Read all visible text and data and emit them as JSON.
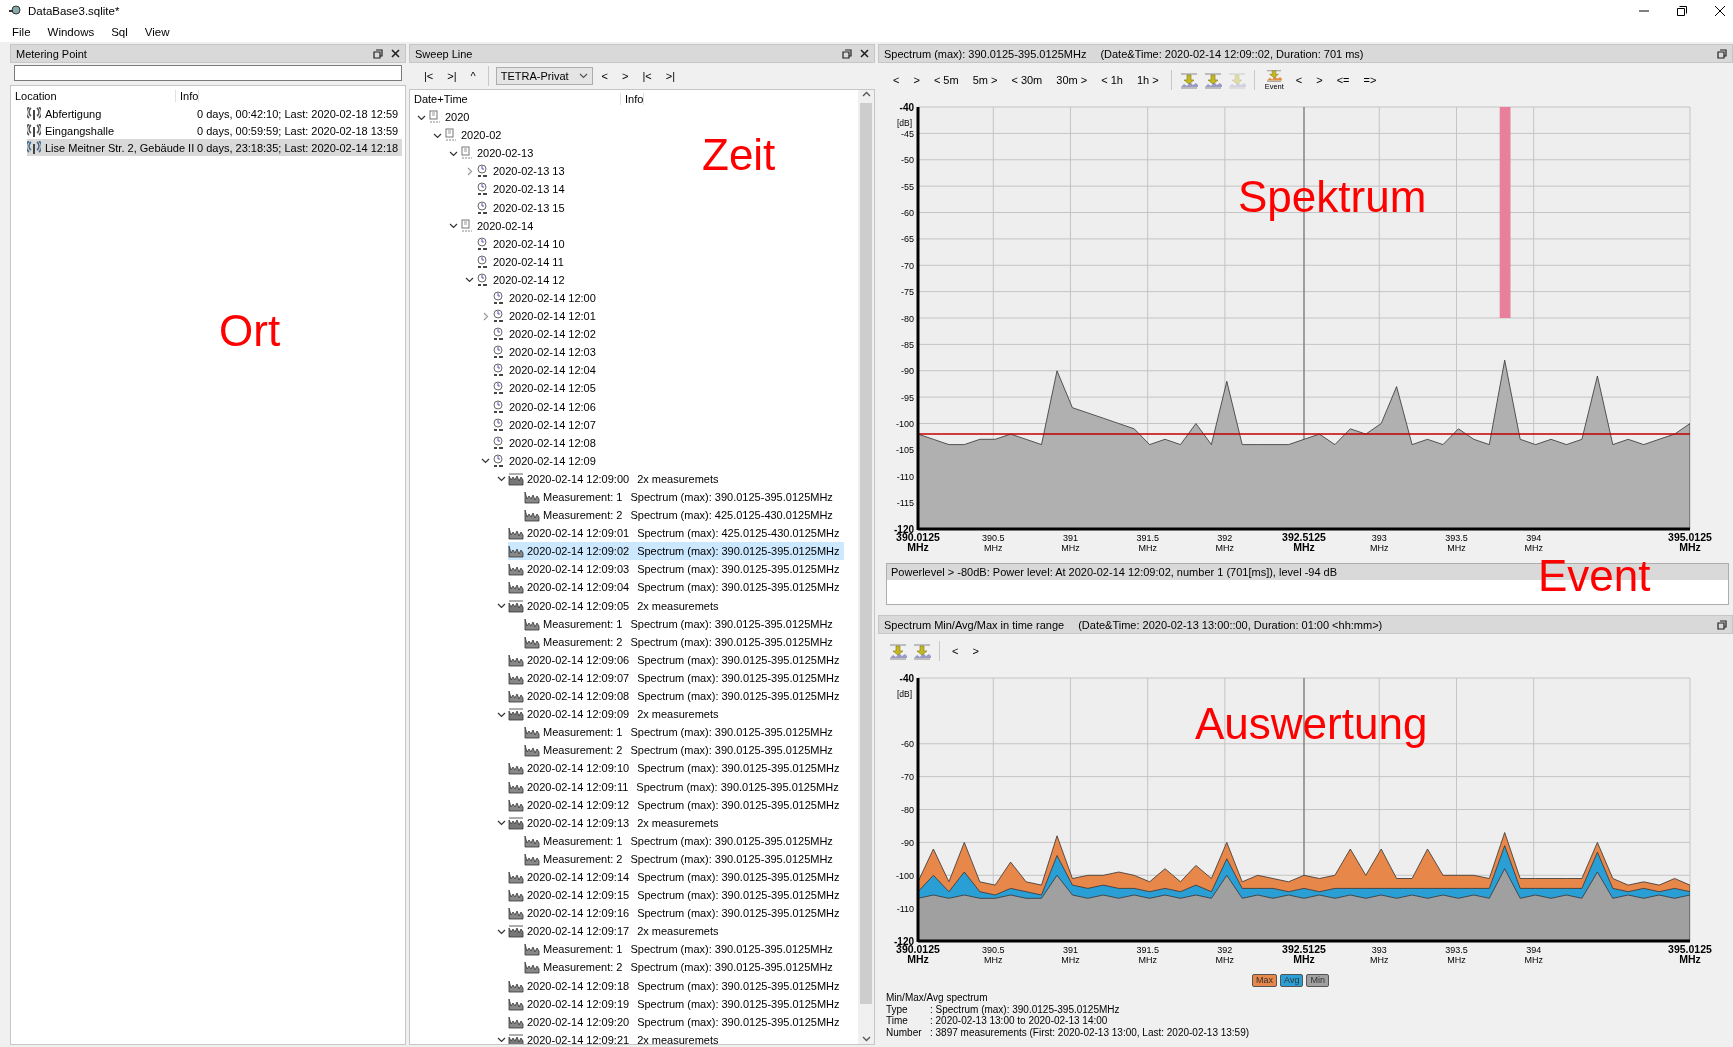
{
  "window": {
    "title": "DataBase3.sqlite*"
  },
  "menu": [
    "File",
    "Windows",
    "Sql",
    "View"
  ],
  "metering_point": {
    "title": "Metering Point",
    "columns": [
      "Location",
      "Info"
    ],
    "annotation": "Ort",
    "rows": [
      {
        "location": "Abfertigung",
        "info": "0 days, 00:42:10; Last: 2020-02-18 12:59",
        "selected": false
      },
      {
        "location": "Eingangshalle",
        "info": "0 days, 00:59:59; Last: 2020-02-18 13:59",
        "selected": false
      },
      {
        "location": "Lise Meitner Str. 2, Gebäude II",
        "info": "0 days, 23:18:35; Last: 2020-02-14 12:18",
        "selected": true
      }
    ]
  },
  "sweep_line": {
    "title": "Sweep Line",
    "annotation": "Zeit",
    "toolbar": [
      {
        "kind": "text",
        "label": "|<"
      },
      {
        "kind": "text",
        "label": ">|"
      },
      {
        "kind": "text",
        "label": "^"
      },
      {
        "kind": "separator"
      },
      {
        "kind": "dropdown",
        "label": "TETRA-Privat"
      },
      {
        "kind": "text",
        "label": "<"
      },
      {
        "kind": "text",
        "label": ">"
      },
      {
        "kind": "text",
        "label": "|<"
      },
      {
        "kind": "text",
        "label": ">|"
      }
    ],
    "columns": [
      "Date+Time",
      "Info"
    ],
    "tree": [
      {
        "label": "2020",
        "kind": "year",
        "expanded": true,
        "selected": false,
        "children": [
          {
            "label": "2020-02",
            "kind": "month",
            "expanded": true,
            "selected": false,
            "children": [
              {
                "label": "2020-02-13",
                "kind": "day",
                "expanded": true,
                "selected": false,
                "children": [
                  {
                    "label": "2020-02-13 13",
                    "kind": "hour",
                    "expanded": false,
                    "selected": false
                  },
                  {
                    "label": "2020-02-13 14",
                    "kind": "hour",
                    "selected": false
                  },
                  {
                    "label": "2020-02-13 15",
                    "kind": "hour",
                    "selected": false
                  }
                ]
              },
              {
                "label": "2020-02-14",
                "kind": "day",
                "expanded": true,
                "selected": false,
                "children": [
                  {
                    "label": "2020-02-14 10",
                    "kind": "hour",
                    "selected": false
                  },
                  {
                    "label": "2020-02-14 11",
                    "kind": "hour",
                    "selected": false
                  },
                  {
                    "label": "2020-02-14 12",
                    "kind": "hour",
                    "expanded": true,
                    "selected": false,
                    "children": [
                      {
                        "label": "2020-02-14 12:00",
                        "kind": "minute",
                        "selected": false
                      },
                      {
                        "label": "2020-02-14 12:01",
                        "kind": "minute",
                        "expanded": false,
                        "selected": false
                      },
                      {
                        "label": "2020-02-14 12:02",
                        "kind": "minute",
                        "selected": false
                      },
                      {
                        "label": "2020-02-14 12:03",
                        "kind": "minute",
                        "selected": false
                      },
                      {
                        "label": "2020-02-14 12:04",
                        "kind": "minute",
                        "selected": false
                      },
                      {
                        "label": "2020-02-14 12:05",
                        "kind": "minute",
                        "selected": false
                      },
                      {
                        "label": "2020-02-14 12:06",
                        "kind": "minute",
                        "selected": false
                      },
                      {
                        "label": "2020-02-14 12:07",
                        "kind": "minute",
                        "selected": false
                      },
                      {
                        "label": "2020-02-14 12:08",
                        "kind": "minute",
                        "selected": false
                      },
                      {
                        "label": "2020-02-14 12:09",
                        "kind": "minute",
                        "expanded": true,
                        "selected": false,
                        "children": [
                          {
                            "label": "2020-02-14 12:09:00",
                            "info": "2x measuremets",
                            "kind": "group",
                            "expanded": true,
                            "selected": false,
                            "children": [
                              {
                                "label": "Measurement: 1",
                                "info": "Spectrum (max): 390.0125-395.0125MHz",
                                "kind": "spectrum",
                                "selected": false
                              },
                              {
                                "label": "Measurement: 2",
                                "info": "Spectrum (max): 425.0125-430.0125MHz",
                                "kind": "spectrum",
                                "selected": false
                              }
                            ]
                          },
                          {
                            "label": "2020-02-14 12:09:01",
                            "info": "Spectrum (max): 425.0125-430.0125MHz",
                            "kind": "spectrum",
                            "selected": false
                          },
                          {
                            "label": "2020-02-14 12:09:02",
                            "info": "Spectrum (max): 390.0125-395.0125MHz",
                            "kind": "spectrum",
                            "selected": true
                          },
                          {
                            "label": "2020-02-14 12:09:03",
                            "info": "Spectrum (max): 390.0125-395.0125MHz",
                            "kind": "spectrum",
                            "selected": false
                          },
                          {
                            "label": "2020-02-14 12:09:04",
                            "info": "Spectrum (max): 390.0125-395.0125MHz",
                            "kind": "spectrum",
                            "selected": false
                          },
                          {
                            "label": "2020-02-14 12:09:05",
                            "info": "2x measuremets",
                            "kind": "group",
                            "expanded": true,
                            "selected": false,
                            "children": [
                              {
                                "label": "Measurement: 1",
                                "info": "Spectrum (max): 390.0125-395.0125MHz",
                                "kind": "spectrum",
                                "selected": false
                              },
                              {
                                "label": "Measurement: 2",
                                "info": "Spectrum (max): 390.0125-395.0125MHz",
                                "kind": "spectrum",
                                "selected": false
                              }
                            ]
                          },
                          {
                            "label": "2020-02-14 12:09:06",
                            "info": "Spectrum (max): 390.0125-395.0125MHz",
                            "kind": "spectrum",
                            "selected": false
                          },
                          {
                            "label": "2020-02-14 12:09:07",
                            "info": "Spectrum (max): 390.0125-395.0125MHz",
                            "kind": "spectrum",
                            "selected": false
                          },
                          {
                            "label": "2020-02-14 12:09:08",
                            "info": "Spectrum (max): 390.0125-395.0125MHz",
                            "kind": "spectrum",
                            "selected": false
                          },
                          {
                            "label": "2020-02-14 12:09:09",
                            "info": "2x measuremets",
                            "kind": "group",
                            "expanded": true,
                            "selected": false,
                            "children": [
                              {
                                "label": "Measurement: 1",
                                "info": "Spectrum (max): 390.0125-395.0125MHz",
                                "kind": "spectrum",
                                "selected": false
                              },
                              {
                                "label": "Measurement: 2",
                                "info": "Spectrum (max): 390.0125-395.0125MHz",
                                "kind": "spectrum",
                                "selected": false
                              }
                            ]
                          },
                          {
                            "label": "2020-02-14 12:09:10",
                            "info": "Spectrum (max): 390.0125-395.0125MHz",
                            "kind": "spectrum",
                            "selected": false
                          },
                          {
                            "label": "2020-02-14 12:09:11",
                            "info": "Spectrum (max): 390.0125-395.0125MHz",
                            "kind": "spectrum",
                            "selected": false
                          },
                          {
                            "label": "2020-02-14 12:09:12",
                            "info": "Spectrum (max): 390.0125-395.0125MHz",
                            "kind": "spectrum",
                            "selected": false
                          },
                          {
                            "label": "2020-02-14 12:09:13",
                            "info": "2x measuremets",
                            "kind": "group",
                            "expanded": true,
                            "selected": false,
                            "children": [
                              {
                                "label": "Measurement: 1",
                                "info": "Spectrum (max): 390.0125-395.0125MHz",
                                "kind": "spectrum",
                                "selected": false
                              },
                              {
                                "label": "Measurement: 2",
                                "info": "Spectrum (max): 390.0125-395.0125MHz",
                                "kind": "spectrum",
                                "selected": false
                              }
                            ]
                          },
                          {
                            "label": "2020-02-14 12:09:14",
                            "info": "Spectrum (max): 390.0125-395.0125MHz",
                            "kind": "spectrum",
                            "selected": false
                          },
                          {
                            "label": "2020-02-14 12:09:15",
                            "info": "Spectrum (max): 390.0125-395.0125MHz",
                            "kind": "spectrum",
                            "selected": false
                          },
                          {
                            "label": "2020-02-14 12:09:16",
                            "info": "Spectrum (max): 390.0125-395.0125MHz",
                            "kind": "spectrum",
                            "selected": false
                          },
                          {
                            "label": "2020-02-14 12:09:17",
                            "info": "2x measuremets",
                            "kind": "group",
                            "expanded": true,
                            "selected": false,
                            "children": [
                              {
                                "label": "Measurement: 1",
                                "info": "Spectrum (max): 390.0125-395.0125MHz",
                                "kind": "spectrum",
                                "selected": false
                              },
                              {
                                "label": "Measurement: 2",
                                "info": "Spectrum (max): 390.0125-395.0125MHz",
                                "kind": "spectrum",
                                "selected": false
                              }
                            ]
                          },
                          {
                            "label": "2020-02-14 12:09:18",
                            "info": "Spectrum (max): 390.0125-395.0125MHz",
                            "kind": "spectrum",
                            "selected": false
                          },
                          {
                            "label": "2020-02-14 12:09:19",
                            "info": "Spectrum (max): 390.0125-395.0125MHz",
                            "kind": "spectrum",
                            "selected": false
                          },
                          {
                            "label": "2020-02-14 12:09:20",
                            "info": "Spectrum (max): 390.0125-395.0125MHz",
                            "kind": "spectrum",
                            "selected": false
                          },
                          {
                            "label": "2020-02-14 12:09:21",
                            "info": "2x measuremets",
                            "kind": "group",
                            "expanded": true,
                            "selected": false
                          }
                        ]
                      }
                    ]
                  }
                ]
              }
            ]
          }
        ]
      }
    ]
  },
  "spectrum": {
    "title": "Spectrum (max): 390.0125-395.0125MHz",
    "subtitle": "(Date&Time: 2020-02-14 12:09::02, Duration: 701 ms)",
    "annotation": "Spektrum",
    "toolbar": [
      {
        "kind": "text",
        "label": "<"
      },
      {
        "kind": "text",
        "label": ">"
      },
      {
        "kind": "text",
        "label": "< 5m"
      },
      {
        "kind": "text",
        "label": "5m >"
      },
      {
        "kind": "text",
        "label": "< 30m"
      },
      {
        "kind": "text",
        "label": "30m >"
      },
      {
        "kind": "text",
        "label": "< 1h"
      },
      {
        "kind": "text",
        "label": "1h >"
      },
      {
        "kind": "separator"
      },
      {
        "kind": "icon",
        "disabled": false
      },
      {
        "kind": "icon",
        "disabled": false
      },
      {
        "kind": "icon",
        "disabled": true
      },
      {
        "kind": "separator"
      },
      {
        "kind": "event",
        "label": "Event"
      },
      {
        "kind": "text",
        "label": "<"
      },
      {
        "kind": "text",
        "label": ">"
      },
      {
        "kind": "text",
        "label": "<="
      },
      {
        "kind": "text",
        "label": "=>"
      }
    ],
    "chart_data": {
      "type": "area",
      "ylabel": "[dB]",
      "xlim": [
        390.0125,
        395.0125
      ],
      "ylim": [
        -120,
        -40
      ],
      "x": [
        390.0125,
        390.1125,
        390.2125,
        390.3125,
        390.4125,
        390.5125,
        390.6125,
        390.7125,
        390.8125,
        390.9125,
        391.0125,
        391.1125,
        391.2125,
        391.3125,
        391.4125,
        391.5125,
        391.6125,
        391.7125,
        391.8125,
        391.9125,
        392.0125,
        392.1125,
        392.2125,
        392.3125,
        392.4125,
        392.5125,
        392.6125,
        392.7125,
        392.8125,
        392.9125,
        393.0125,
        393.1125,
        393.2125,
        393.3125,
        393.4125,
        393.5125,
        393.6125,
        393.7125,
        393.8125,
        393.9125,
        394.0125,
        394.1125,
        394.2125,
        394.3125,
        394.4125,
        394.5125,
        394.6125,
        394.7125,
        394.8125,
        394.9125,
        395.0125
      ],
      "values": [
        -102,
        -103,
        -104,
        -104,
        -103,
        -103,
        -102,
        -103,
        -104,
        -90,
        -97,
        -98,
        -99,
        -100,
        -101,
        -104,
        -103,
        -104,
        -100,
        -104,
        -92,
        -104,
        -104,
        -104,
        -104,
        -103,
        -102,
        -104,
        -101,
        -102,
        -100,
        -93,
        -104,
        -103,
        -104,
        -101,
        -103,
        -104,
        -88,
        -103,
        -104,
        -103,
        -104,
        -103,
        -91,
        -104,
        -103,
        -104,
        -103,
        -102,
        -100
      ],
      "yticks": [
        -40,
        -45,
        -50,
        -55,
        -60,
        -65,
        -70,
        -75,
        -80,
        -85,
        -90,
        -95,
        -100,
        -105,
        -110,
        -115,
        -120
      ],
      "xticks": [
        {
          "value": 390.0125,
          "label": "390.0125 MHz"
        },
        {
          "value": 390.5,
          "label": "390.5 MHz"
        },
        {
          "value": 391,
          "label": "391 MHz"
        },
        {
          "value": 391.5,
          "label": "391.5 MHz"
        },
        {
          "value": 392,
          "label": "392 MHz"
        },
        {
          "value": 392.5125,
          "label": "392.5125 MHz"
        },
        {
          "value": 393,
          "label": "393 MHz"
        },
        {
          "value": 393.5,
          "label": "393.5 MHz"
        },
        {
          "value": 394,
          "label": "394 MHz"
        },
        {
          "value": 395.0125,
          "label": "395.0125 MHz"
        }
      ],
      "grid": true,
      "ref_lines": [
        {
          "axis": "x",
          "value": 392.5125,
          "color": "#777777"
        },
        {
          "axis": "y",
          "value": -102,
          "color": "#c00000"
        }
      ],
      "bands": [
        {
          "axis": "x",
          "from": 393.78,
          "to": 393.85,
          "color": "#e8809c"
        }
      ]
    }
  },
  "events": {
    "annotation": "Event",
    "rows": [
      {
        "text": "Powerlevel > -80dB: Power level: At 2020-02-14 12:09:02, number 1 (701[ms]), level -94 dB",
        "selected": true
      }
    ]
  },
  "min_avg_max": {
    "title": "Spectrum Min/Avg/Max in time range",
    "subtitle": "(Date&Time: 2020-02-13 13:00::00, Duration: 01:00 <hh:mm>)",
    "annotation": "Auswertung",
    "toolbar": [
      {
        "kind": "icon",
        "disabled": false
      },
      {
        "kind": "icon",
        "disabled": false
      },
      {
        "kind": "separator"
      },
      {
        "kind": "text",
        "label": "<"
      },
      {
        "kind": "text",
        "label": ">"
      }
    ],
    "chart_data": {
      "type": "area",
      "ylabel": "[dB]",
      "xlim": [
        390.0125,
        395.0125
      ],
      "ylim": [
        -120,
        -40
      ],
      "x": [
        390.0125,
        390.1125,
        390.2125,
        390.3125,
        390.4125,
        390.5125,
        390.6125,
        390.7125,
        390.8125,
        390.9125,
        391.0125,
        391.1125,
        391.2125,
        391.3125,
        391.4125,
        391.5125,
        391.6125,
        391.7125,
        391.8125,
        391.9125,
        392.0125,
        392.1125,
        392.2125,
        392.3125,
        392.4125,
        392.5125,
        392.6125,
        392.7125,
        392.8125,
        392.9125,
        393.0125,
        393.1125,
        393.2125,
        393.3125,
        393.4125,
        393.5125,
        393.6125,
        393.7125,
        393.8125,
        393.9125,
        394.0125,
        394.1125,
        394.2125,
        394.3125,
        394.4125,
        394.5125,
        394.6125,
        394.7125,
        394.8125,
        394.9125,
        395.0125
      ],
      "series": [
        {
          "name": "Max",
          "color": "#e8874a",
          "values": [
            -102,
            -92,
            -102,
            -90,
            -102,
            -103,
            -96,
            -102,
            -103,
            -88,
            -101,
            -100,
            -100,
            -99,
            -100,
            -102,
            -98,
            -102,
            -97,
            -101,
            -90,
            -102,
            -100,
            -101,
            -102,
            -100,
            -101,
            -100,
            -92,
            -100,
            -92,
            -101,
            -101,
            -92,
            -100,
            -100,
            -100,
            -101,
            -87,
            -101,
            -101,
            -101,
            -101,
            -101,
            -90,
            -101,
            -103,
            -102,
            -103,
            -101,
            -103
          ]
        },
        {
          "name": "Avg",
          "color": "#2a9fd6",
          "values": [
            -105,
            -100,
            -105,
            -99,
            -105,
            -106,
            -104,
            -105,
            -106,
            -94,
            -103,
            -104,
            -103,
            -104,
            -104,
            -105,
            -104,
            -105,
            -103,
            -105,
            -95,
            -104,
            -104,
            -104,
            -105,
            -104,
            -105,
            -104,
            -104,
            -104,
            -104,
            -104,
            -104,
            -104,
            -104,
            -104,
            -104,
            -104,
            -91,
            -104,
            -104,
            -104,
            -104,
            -104,
            -93,
            -104,
            -105,
            -104,
            -105,
            -104,
            -105
          ]
        },
        {
          "name": "Min",
          "color": "#a0a0a0",
          "values": [
            -107,
            -106,
            -107,
            -106,
            -107,
            -107,
            -106,
            -107,
            -107,
            -100,
            -106,
            -107,
            -106,
            -107,
            -106,
            -107,
            -106,
            -107,
            -106,
            -107,
            -100,
            -107,
            -106,
            -107,
            -106,
            -107,
            -106,
            -107,
            -106,
            -107,
            -106,
            -107,
            -106,
            -107,
            -106,
            -107,
            -106,
            -107,
            -98,
            -107,
            -106,
            -107,
            -106,
            -107,
            -99,
            -107,
            -106,
            -107,
            -106,
            -107,
            -106
          ]
        }
      ],
      "yticks": [
        -40,
        -60,
        -70,
        -80,
        -90,
        -100,
        -110,
        -120
      ],
      "xticks": [
        {
          "value": 390.0125,
          "label": "390.0125 MHz"
        },
        {
          "value": 390.5,
          "label": "390.5 MHz"
        },
        {
          "value": 391,
          "label": "391 MHz"
        },
        {
          "value": 391.5,
          "label": "391.5 MHz"
        },
        {
          "value": 392,
          "label": "392 MHz"
        },
        {
          "value": 392.5125,
          "label": "392.5125 MHz"
        },
        {
          "value": 393,
          "label": "393 MHz"
        },
        {
          "value": 393.5,
          "label": "393.5 MHz"
        },
        {
          "value": 394,
          "label": "394 MHz"
        },
        {
          "value": 395.0125,
          "label": "395.0125 MHz"
        }
      ],
      "grid": true,
      "ref_lines": [
        {
          "axis": "x",
          "value": 392.5125,
          "color": "#777777"
        }
      ]
    },
    "summary": {
      "heading": "Min/Max/Avg spectrum",
      "rows": [
        {
          "label": "Type",
          "value": ": Spectrum (max): 390.0125-395.0125MHz"
        },
        {
          "label": "Time",
          "value": ": 2020-02-13 13:00 to 2020-02-13 14:00"
        },
        {
          "label": "Number",
          "value": ": 3897 measurements (First: 2020-02-13 13:00, Last: 2020-02-13 13:59)"
        }
      ]
    }
  }
}
